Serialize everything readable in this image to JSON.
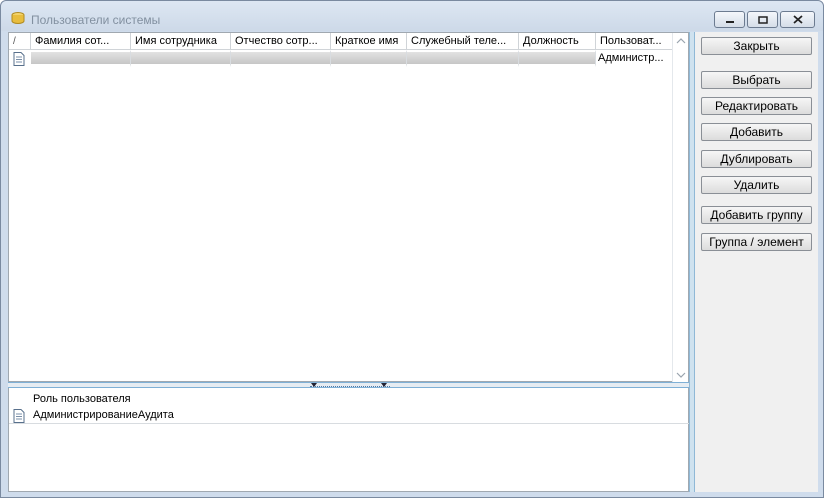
{
  "window": {
    "title": "Пользователи системы"
  },
  "grid": {
    "sort_mark": "/",
    "columns": [
      "Фамилия сот...",
      "Имя сотрудника",
      "Отчество сотр...",
      "Краткое имя",
      "Служебный теле...",
      "Должность",
      "Пользоват..."
    ],
    "rows": [
      {
        "user": "Администр..."
      }
    ]
  },
  "subgrid": {
    "header": "Роль пользователя",
    "rows": [
      "АдминистрированиеАудита"
    ]
  },
  "buttons": {
    "close": "Закрыть",
    "select": "Выбрать",
    "edit": "Редактировать",
    "add": "Добавить",
    "duplicate": "Дублировать",
    "delete": "Удалить",
    "add_group": "Добавить группу",
    "group_element": "Группа / элемент"
  }
}
